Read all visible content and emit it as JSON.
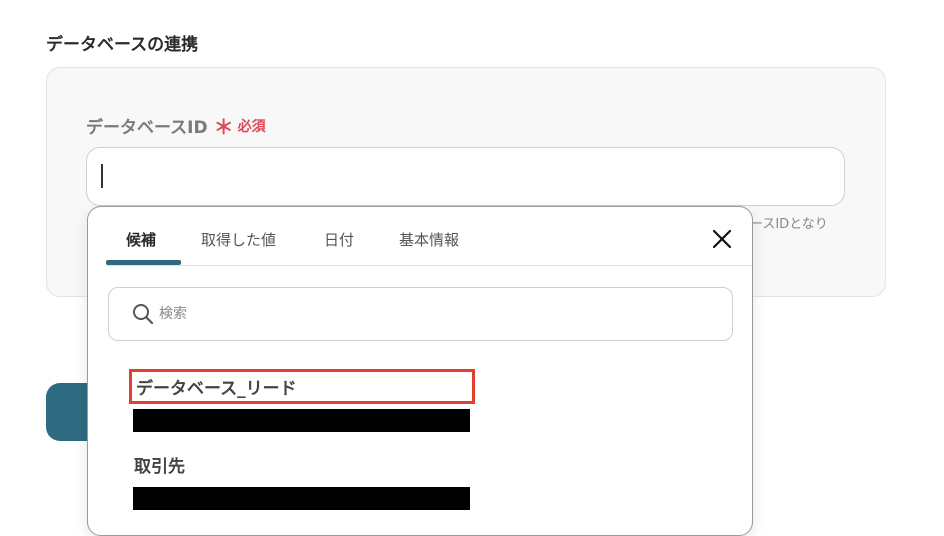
{
  "section": {
    "title": "データベースの連携"
  },
  "field": {
    "label": "データベースID",
    "required_mark": "＊",
    "required_text": "必須",
    "value": "",
    "hint": "ースIDとなり"
  },
  "dropdown": {
    "tabs": [
      {
        "label": "候補",
        "active": true
      },
      {
        "label": "取得した値",
        "active": false
      },
      {
        "label": "日付",
        "active": false
      },
      {
        "label": "基本情報",
        "active": false
      }
    ],
    "search_placeholder": "検索",
    "options": [
      {
        "title": "データベース_リード",
        "highlighted": true
      },
      {
        "title": "取引先",
        "highlighted": false
      }
    ]
  },
  "colors": {
    "accent": "#2e6b82",
    "required": "#e0475a",
    "highlight_box": "#e0402d"
  },
  "icons": {
    "close": "close-icon",
    "search": "search-icon"
  }
}
